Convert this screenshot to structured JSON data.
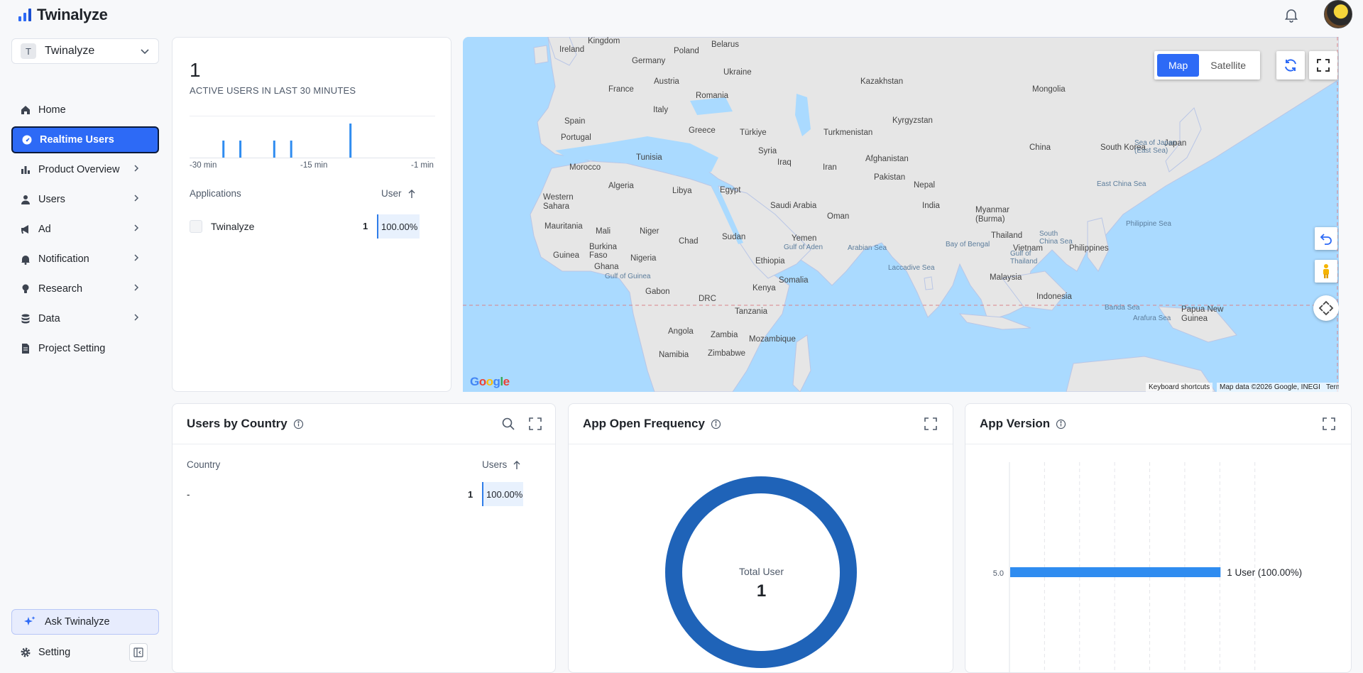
{
  "app": {
    "name": "Twinalyze"
  },
  "sidebar": {
    "project": {
      "badge": "T",
      "name": "Twinalyze"
    },
    "items": [
      {
        "label": "Home",
        "icon": "home-icon"
      },
      {
        "label": "Realtime Users",
        "icon": "speedometer-icon",
        "active": true
      },
      {
        "label": "Product Overview",
        "icon": "bar-chart-icon"
      },
      {
        "label": "Users",
        "icon": "user-icon"
      },
      {
        "label": "Ad",
        "icon": "megaphone-icon"
      },
      {
        "label": "Notification",
        "icon": "bell-icon"
      },
      {
        "label": "Research",
        "icon": "lightbulb-icon"
      },
      {
        "label": "Data",
        "icon": "database-icon"
      },
      {
        "label": "Project Setting",
        "icon": "document-icon"
      }
    ],
    "ask": "Ask Twinalyze",
    "setting": "Setting"
  },
  "realtime": {
    "count": "1",
    "subtitle": "ACTIVE USERS IN LAST 30 MINUTES",
    "ticks": [
      "-30 min",
      "-15 min",
      "-1 min"
    ],
    "bars_minutes_ago": [
      26,
      24,
      20,
      18,
      11
    ],
    "apps_header": {
      "col1": "Applications",
      "col2": "User"
    },
    "apps": [
      {
        "name": "Twinalyze",
        "value": "1",
        "pct": "100.00%"
      }
    ]
  },
  "map": {
    "type_buttons": [
      "Map",
      "Satellite"
    ],
    "labels": {
      "kingdom": "Kingdom",
      "ireland": "Ireland",
      "belarus": "Belarus",
      "poland": "Poland",
      "germany": "Germany",
      "ukraine": "Ukraine",
      "austria": "Austria",
      "france": "France",
      "romania": "Romania",
      "italy": "Italy",
      "kazakhstan": "Kazakhstan",
      "mongolia": "Mongolia",
      "spain": "Spain",
      "portugal": "Portugal",
      "greece": "Greece",
      "turkiye": "Türkiye",
      "turkmenistan": "Turkmenistan",
      "kyrgyzstan": "Kyrgyzstan",
      "tunisia": "Tunisia",
      "morocco": "Morocco",
      "syria": "Syria",
      "iraq": "Iraq",
      "iran": "Iran",
      "afghanistan": "Afghanistan",
      "pakistan": "Pakistan",
      "china": "China",
      "south_korea": "South Korea",
      "japan": "Japan",
      "algeria": "Algeria",
      "libya": "Libya",
      "egypt": "Egypt",
      "western_sahara": "Western\nSahara",
      "saudi_arabia": "Saudi Arabia",
      "nepal": "Nepal",
      "india": "India",
      "oman": "Oman",
      "myanmar": "Myanmar\n(Burma)",
      "mauritania": "Mauritania",
      "mali": "Mali",
      "niger": "Niger",
      "chad": "Chad",
      "sudan": "Sudan",
      "yemen": "Yemen",
      "thailand": "Thailand",
      "burkina_faso": "Burkina\nFaso",
      "guinea": "Guinea",
      "nigeria": "Nigeria",
      "ghana": "Ghana",
      "ethiopia": "Ethiopia",
      "vietnam": "Vietnam",
      "philippines": "Philippines",
      "somalia": "Somalia",
      "gabon": "Gabon",
      "kenya": "Kenya",
      "drc": "DRC",
      "malaysia": "Malaysia",
      "tanzania": "Tanzania",
      "indonesia": "Indonesia",
      "angola": "Angola",
      "zambia": "Zambia",
      "mozambique": "Mozambique",
      "papua_new_guinea": "Papua New\nGuinea",
      "namibia": "Namibia",
      "zimbabwe": "Zimbabwe"
    },
    "seas": {
      "sea_of_japan": "Sea of Japan\n(East Sea)",
      "east_china_sea": "East China Sea",
      "philippine_sea": "Philippine Sea",
      "south_china_sea": "South\nChina Sea",
      "bay_of_bengal": "Bay of Bengal",
      "arabian_sea": "Arabian Sea",
      "gulf_of_aden": "Gulf of Aden",
      "gulf_of_thailand": "Gulf of\nThailand",
      "laccadive_sea": "Laccadive Sea",
      "gulf_of_guinea": "Gulf of Guinea",
      "banda_sea": "Banda Sea",
      "arafura_sea": "Arafura Sea"
    },
    "google": "Google",
    "attribution": [
      "Keyboard shortcuts",
      "Map data ©2026 Google, INEGI",
      "Terms"
    ]
  },
  "users_by_country": {
    "title": "Users by Country",
    "header": {
      "col1": "Country",
      "col2": "Users"
    },
    "rows": [
      {
        "country": "-",
        "value": "1",
        "pct": "100.00%"
      }
    ]
  },
  "app_open_frequency": {
    "title": "App Open Frequency",
    "center_label": "Total User",
    "center_value": "1"
  },
  "app_version": {
    "title": "App Version",
    "chart_data": {
      "type": "bar",
      "orientation": "horizontal",
      "categories": [
        "5.0"
      ],
      "values": [
        1
      ],
      "data_labels": [
        "1 User (100.00%)"
      ]
    }
  },
  "colors": {
    "accent": "#2d6af6",
    "bar": "#2f8cf0",
    "donut": "#1f63b8"
  }
}
